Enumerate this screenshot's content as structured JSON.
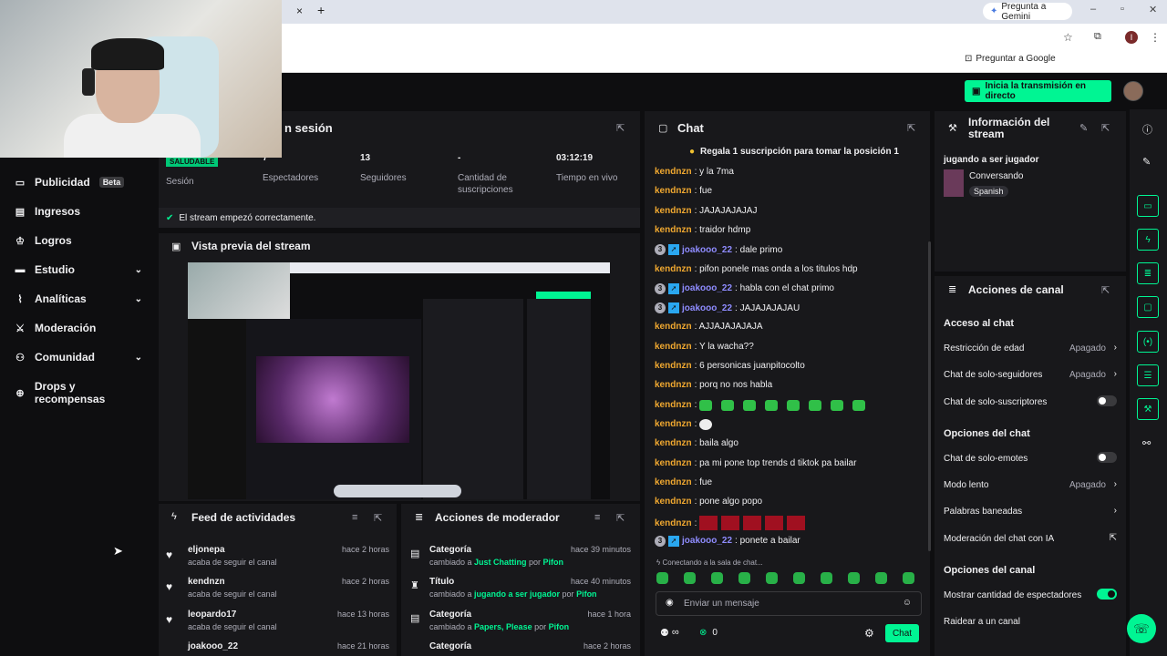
{
  "browser": {
    "ask_gemini": "Pregunta a Gemini",
    "ask_google": "Preguntar a Google",
    "close_tab": "×",
    "new_tab": "+",
    "profile": "I"
  },
  "header": {
    "go_live": "Inicia la transmisión en directo"
  },
  "sidebar": {
    "items": [
      {
        "label": "Publicidad",
        "badge": "Beta",
        "icon": "display-icon"
      },
      {
        "label": "Ingresos",
        "icon": "chart-icon"
      },
      {
        "label": "Logros",
        "icon": "trophy-icon"
      },
      {
        "label": "Estudio",
        "icon": "studio-icon",
        "chevron": "⌄"
      },
      {
        "label": "Analíticas",
        "icon": "analytics-icon",
        "chevron": "⌄"
      },
      {
        "label": "Moderación",
        "icon": "sword-icon"
      },
      {
        "label": "Comunidad",
        "icon": "community-icon",
        "chevron": "⌄"
      },
      {
        "label": "Drops y recompensas",
        "icon": "gift-icon"
      }
    ]
  },
  "session": {
    "title": "n sesión",
    "health": "SALUDABLE",
    "health_label": "Sesión",
    "viewers": "7",
    "viewers_label": "Espectadores",
    "followers": "13",
    "followers_label": "Seguidores",
    "subs": "-",
    "subs_label": "Cantidad de suscripciones",
    "live_time": "03:12:19",
    "live_time_label": "Tiempo en vivo",
    "ok_message": "El stream empezó correctamente."
  },
  "preview": {
    "title": "Vista previa del stream"
  },
  "feed": {
    "title": "Feed de actividades",
    "items": [
      {
        "name": "eljonepa",
        "sub": "acaba de seguir el canal",
        "time": "hace 2 horas"
      },
      {
        "name": "kendnzn",
        "sub": "acaba de seguir el canal",
        "time": "hace 2 horas"
      },
      {
        "name": "leopardo17",
        "sub": "acaba de seguir el canal",
        "time": "hace 13 horas"
      },
      {
        "name": "joakooo_22",
        "sub": "",
        "time": "hace 21 horas"
      }
    ]
  },
  "mod": {
    "title": "Acciones de moderador",
    "items": [
      {
        "name": "Categoría",
        "pre": "cambiado a ",
        "val": "Just Chatting",
        "mid": " por ",
        "by": "Pifon",
        "time": "hace 39 minutos"
      },
      {
        "name": "Título",
        "pre": "cambiado a ",
        "val": "jugando a ser jugador",
        "mid": " por ",
        "by": "Pifon",
        "time": "hace 40 minutos"
      },
      {
        "name": "Categoría",
        "pre": "cambiado a ",
        "val": "Papers, Please",
        "mid": " por ",
        "by": "Pifon",
        "time": "hace 1 hora"
      },
      {
        "name": "Categoría",
        "pre": "",
        "val": "",
        "mid": "",
        "by": "",
        "time": "hace 2 horas"
      }
    ]
  },
  "chat": {
    "title": "Chat",
    "pinned": "Regala 1 suscripción para tomar la posición 1",
    "messages": [
      {
        "user": "kendnzn",
        "text": ": y la 7ma"
      },
      {
        "user": "kendnzn",
        "text": ": fue"
      },
      {
        "user": "kendnzn",
        "text": ": JAJAJAJAJAJ"
      },
      {
        "user": "kendnzn",
        "text": ": traidor hdmp"
      },
      {
        "user": "joakooo_22",
        "text": ": dale primo",
        "badges": true
      },
      {
        "user": "kendnzn",
        "text": ": pifon ponele mas onda a los titulos hdp"
      },
      {
        "user": "joakooo_22",
        "text": ": habla con el chat primo",
        "badges": true
      },
      {
        "user": "joakooo_22",
        "text": ": JAJAJAJAJAU",
        "badges": true
      },
      {
        "user": "kendnzn",
        "text": ": AJJAJAJAJAJA"
      },
      {
        "user": "kendnzn",
        "text": ": Y la wacha??"
      },
      {
        "user": "kendnzn",
        "text": ": 6 personicas juanpitocolto"
      },
      {
        "user": "kendnzn",
        "text": ": porq no nos habla"
      },
      {
        "user": "kendnzn",
        "text": ":",
        "emotes": 8
      },
      {
        "user": "kendnzn",
        "text": ":",
        "bubble": true
      },
      {
        "user": "kendnzn",
        "text": ": baila algo"
      },
      {
        "user": "kendnzn",
        "text": ": pa mi pone top trends d tiktok pa bailar"
      },
      {
        "user": "kendnzn",
        "text": ": fue"
      },
      {
        "user": "kendnzn",
        "text": ": pone algo popo"
      },
      {
        "user": "kendnzn",
        "text": ":",
        "red": 5
      },
      {
        "user": "joakooo_22",
        "text": ": ponete a bailar",
        "badges": true
      }
    ],
    "connecting": "Conectando a la sala de chat...",
    "placeholder": "Enviar un mensaje",
    "points": "0",
    "send": "Chat",
    "infinity": "∞"
  },
  "info": {
    "title": "Información del stream",
    "stream_title": "jugando a ser jugador",
    "category": "Conversando",
    "language": "Spanish"
  },
  "actions": {
    "title": "Acciones de canal",
    "chat_access": "Acceso al chat",
    "age": "Restricción de edad",
    "age_val": "Apagado",
    "followers_only": "Chat de solo-seguidores",
    "followers_val": "Apagado",
    "subs_only": "Chat de solo-suscriptores",
    "chat_options": "Opciones del chat",
    "emotes_only": "Chat de solo-emotes",
    "slow": "Modo lento",
    "slow_val": "Apagado",
    "banned": "Palabras baneadas",
    "ai_mod": "Moderación del chat con IA",
    "channel_options": "Opciones del canal",
    "show_viewers": "Mostrar cantidad de espectadores",
    "raid": "Raidear a un canal"
  },
  "colors": {
    "accent": "#00f593",
    "bg": "#0e0e10",
    "panel": "#18181b",
    "username": "#f0a830",
    "username2": "#8f8cff"
  }
}
